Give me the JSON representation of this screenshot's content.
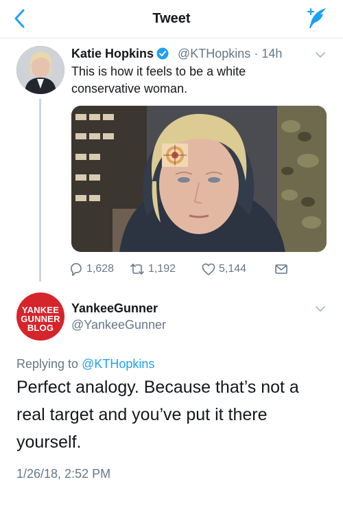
{
  "header": {
    "title": "Tweet"
  },
  "tweet": {
    "name": "Katie Hopkins",
    "handle": "@KTHopkins",
    "time": "· 14h",
    "text": "This is how it feels to be a white conservative woman.",
    "stats": {
      "replies": "1,628",
      "retweets": "1,192",
      "likes": "5,144"
    }
  },
  "reply": {
    "avatar_lines": [
      "YANKEE",
      "GUNNER",
      "BLOG"
    ],
    "name": "YankeeGunner",
    "handle": "@YankeeGunner",
    "replying_prefix": "Replying to",
    "replying_to": "@KTHopkins",
    "text": "Perfect analogy. Because that’s not a real target and you’ve put it there yourself.",
    "timestamp": "1/26/18, 2:52 PM"
  },
  "colors": {
    "accent": "#1da1f2",
    "muted": "#657786",
    "avatar_red": "#d6242b"
  }
}
